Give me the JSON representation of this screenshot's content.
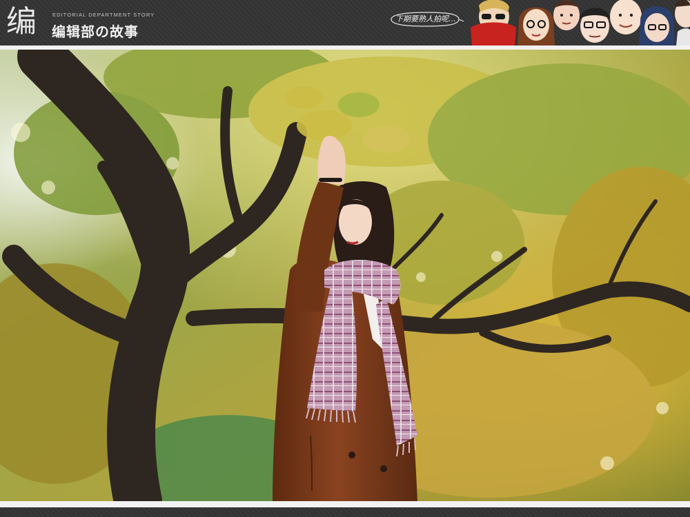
{
  "header": {
    "logo_glyph": "编",
    "logo_en": "EDITORIAL DEPARTMENT STORY",
    "logo_cn": "编辑部の故事",
    "bubble_text": "下期要熟人拍呢…",
    "faces": [
      "red-scarf-face-icon",
      "glasses-woman-face-icon",
      "man-face-icon",
      "man-glasses-face-icon",
      "bald-man-face-icon",
      "man-glasses-2-face-icon",
      "partial-face-icon"
    ]
  },
  "photo": {
    "subject": "woman-in-brown-coat-under-ginkgo-tree",
    "colors": {
      "coat": "#7a3a16",
      "scarf": "#b98aa8",
      "foliage_yellow": "#c9b43a",
      "foliage_green": "#6f8a2a",
      "trunk": "#2e2620"
    }
  }
}
